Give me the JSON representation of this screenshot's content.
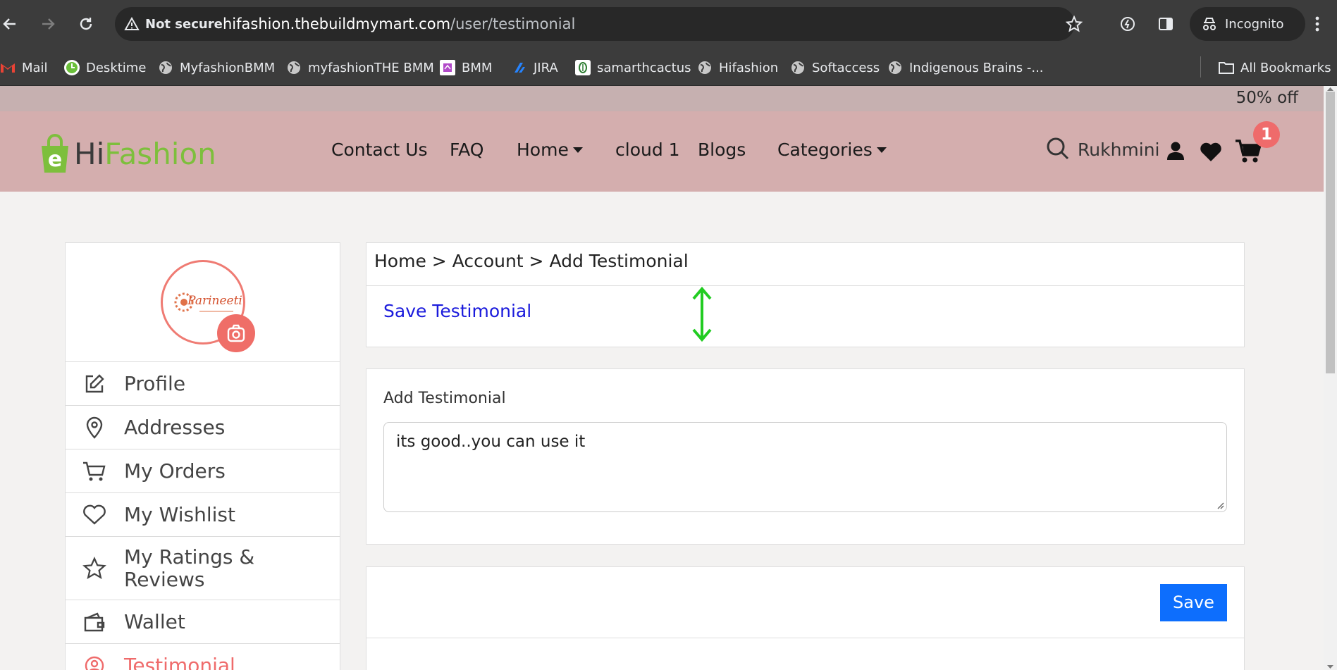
{
  "browser": {
    "not_secure_label": "Not secure",
    "url_host": "hifashion.thebuildmymart.com",
    "url_path": "/user/testimonial",
    "incognito_label": "Incognito"
  },
  "bookmarks": [
    {
      "label": "Mail",
      "icon": "gmail-icon"
    },
    {
      "label": "Desktime",
      "icon": "desktime-icon"
    },
    {
      "label": "MyfashionBMM",
      "icon": "globe-icon"
    },
    {
      "label": "myfashionTHE BMM",
      "icon": "globe-icon"
    },
    {
      "label": "BMM",
      "icon": "bmm-icon"
    },
    {
      "label": "JIRA",
      "icon": "jira-icon"
    },
    {
      "label": "samarthcactus",
      "icon": "cactus-icon"
    },
    {
      "label": "Hifashion",
      "icon": "globe-icon"
    },
    {
      "label": "Softaccess",
      "icon": "globe-icon"
    },
    {
      "label": "Indigenous Brains -...",
      "icon": "globe-icon"
    }
  ],
  "all_bookmarks_label": "All Bookmarks",
  "promo": {
    "text": "50% off"
  },
  "header": {
    "logo_e": "e",
    "logo_hi": "Hi",
    "logo_fashion": "Fashion",
    "menu": {
      "contact": "Contact Us",
      "faq": "FAQ",
      "home": "Home",
      "cloud": "cloud 1",
      "blogs": "Blogs",
      "categories": "Categories"
    },
    "user_name": "Rukhmini",
    "cart_count": "1"
  },
  "sidebar": {
    "avatar_brand": "Parineeti",
    "items": [
      {
        "label": "Profile",
        "icon": "edit-icon"
      },
      {
        "label": "Addresses",
        "icon": "location-pin-icon"
      },
      {
        "label": "My Orders",
        "icon": "cart-icon"
      },
      {
        "label": "My Wishlist",
        "icon": "heart-icon"
      },
      {
        "label": "My Ratings & Reviews",
        "icon": "star-icon"
      },
      {
        "label": "Wallet",
        "icon": "wallet-icon"
      },
      {
        "label": "Testimonial",
        "icon": "user-circle-icon"
      }
    ]
  },
  "main": {
    "breadcrumb": "Home > Account > Add Testimonial",
    "save_testimonial_link": "Save Testimonial",
    "form_label": "Add Testimonial",
    "testimonial_text": "its good..you can use it",
    "save_button": "Save"
  },
  "colors": {
    "header_bg": "#d4aeae",
    "promo_bg": "#c6b0b0",
    "accent": "#ef6b6b",
    "link_blue": "#1a1adc",
    "button_blue": "#0d6efd",
    "logo_green": "#7dbf3c"
  }
}
